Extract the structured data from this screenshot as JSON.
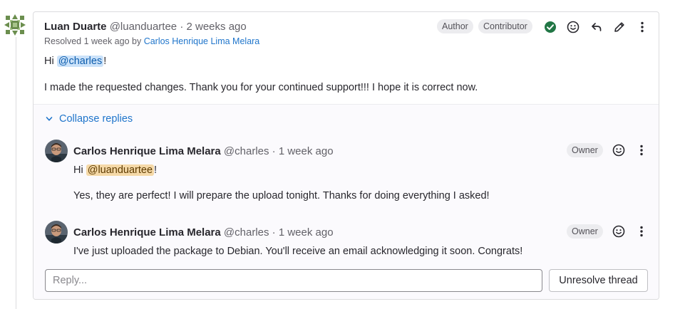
{
  "main_note": {
    "author_name": "Luan Duarte",
    "author_handle": "@luanduartee",
    "separator": "·",
    "time_ago": "2 weeks ago",
    "resolved_prefix": "Resolved 1 week ago by",
    "resolved_by": "Carlos Henrique Lima Melara",
    "badges": [
      "Author",
      "Contributor"
    ],
    "greeting_prefix": "Hi",
    "greeting_mention": "@charles",
    "greeting_suffix": "!",
    "message": "I made the requested changes. Thank you for your continued support!!! I hope it is correct now."
  },
  "replies": {
    "collapse_label": "Collapse replies",
    "items": [
      {
        "author_name": "Carlos Henrique Lima Melara",
        "author_handle": "@charles",
        "separator": "·",
        "time_ago": "1 week ago",
        "badge": "Owner",
        "greeting_prefix": "Hi",
        "greeting_mention": "@luanduartee",
        "greeting_suffix": "!",
        "message": "Yes, they are perfect! I will prepare the upload tonight. Thanks for doing everything I asked!"
      },
      {
        "author_name": "Carlos Henrique Lima Melara",
        "author_handle": "@charles",
        "separator": "·",
        "time_ago": "1 week ago",
        "badge": "Owner",
        "message": "I've just uploaded the package to Debian. You'll receive an email acknowledging it soon. Congrats!"
      }
    ],
    "reply_placeholder": "Reply...",
    "unresolve_label": "Unresolve thread"
  },
  "colors": {
    "link": "#1f75cb",
    "resolved_check": "#217645",
    "mention_bg": "#cbe2f9",
    "self_mention_bg": "#f5d9a8"
  },
  "icons": [
    "identicon-avatar",
    "check-circle-icon",
    "smiley-icon",
    "reply-icon",
    "pencil-icon",
    "ellipsis-v-icon",
    "chevron-down-icon"
  ]
}
